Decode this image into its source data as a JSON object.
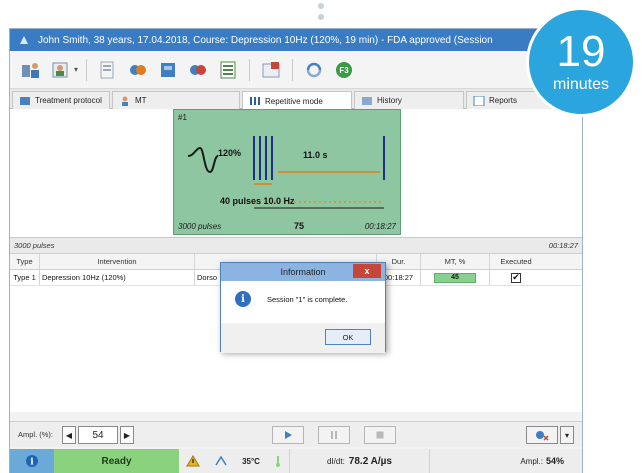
{
  "window": {
    "title": "John Smith, 38 years, 17.04.2018, Course: Depression 10Hz (120%, 19 min) - FDA approved (Session"
  },
  "tabs": [
    {
      "label": "Treatment protocol",
      "icon": "protocol-icon"
    },
    {
      "label": "MT",
      "icon": "person-icon"
    },
    {
      "label": "Repetitive mode",
      "icon": "pulses-icon",
      "active": true
    },
    {
      "label": "History",
      "icon": "history-icon"
    },
    {
      "label": "Reports",
      "icon": "report-icon"
    }
  ],
  "stimulation": {
    "sequence_label": "#1",
    "amplitude": "120%",
    "interval": "11.0 s",
    "train": "40 pulses 10.0 Hz",
    "pulses_total": "3000 pulses",
    "current_count": "75",
    "duration": "00:18:27",
    "colors": {
      "panel": "#8ec6a2",
      "train_lines": "#1f2f8a",
      "interval_line": "#e07b1f"
    }
  },
  "table": {
    "header_info_left": "3000 pulses",
    "header_info_right": "00:18:27",
    "columns": {
      "type": "Type",
      "intervention": "Intervention",
      "duration": "Dur.",
      "mt": "MT, %",
      "executed": "Executed"
    },
    "rows": [
      {
        "type": "Type 1",
        "intervention": "Depression 10Hz (120%)",
        "partial": "Dorso",
        "duration": "00:18:27",
        "mt": "45",
        "executed": "✔"
      }
    ]
  },
  "controls": {
    "ampl_label": "Ampl. (%):",
    "ampl_value": "54"
  },
  "status": {
    "ready": "Ready",
    "temperature": "35°C",
    "dbdt_label": "dI/dt:",
    "dbdt_value": "78.2 A/µs",
    "ampl_label": "Ampl.:",
    "ampl_value": "54%"
  },
  "dialog": {
    "title": "Information",
    "message": "Session \"1\" is complete.",
    "ok": "OK",
    "close": "x"
  },
  "badge": {
    "number": "19",
    "unit": "minutes",
    "color": "#2aa5de"
  }
}
